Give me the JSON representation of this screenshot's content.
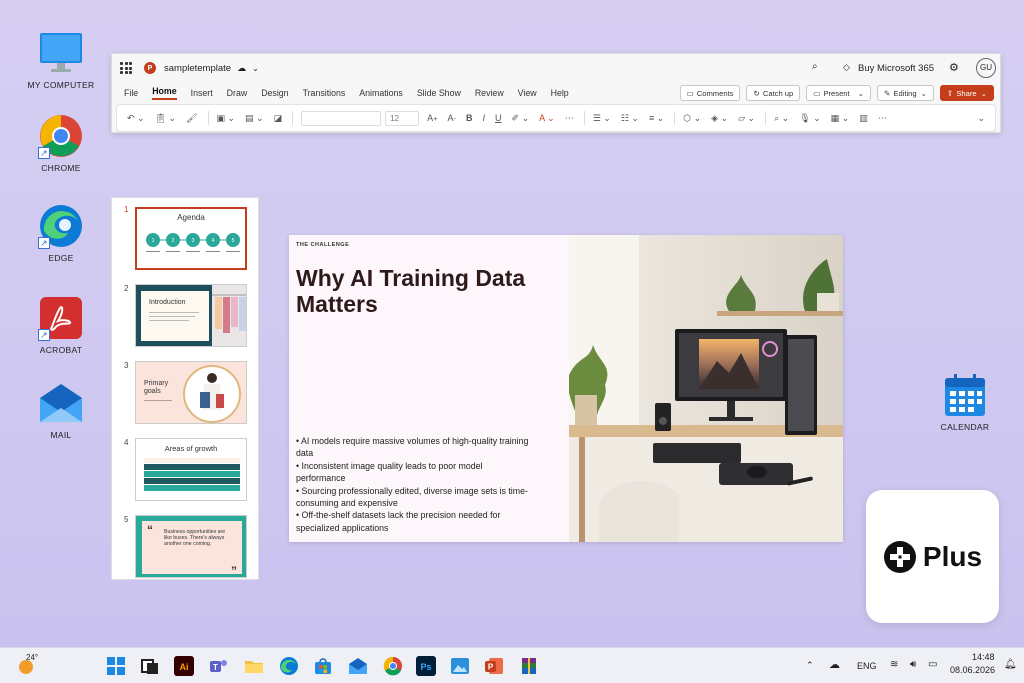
{
  "desktop": {
    "icons": [
      {
        "label": "MY COMPUTER"
      },
      {
        "label": "CHROME"
      },
      {
        "label": "EDGE"
      },
      {
        "label": "ACROBAT"
      },
      {
        "label": "MAIL"
      },
      {
        "label": "CALENDAR"
      }
    ]
  },
  "window": {
    "file_name": "sampletemplate",
    "buy_label": "Buy Microsoft 365",
    "avatar": "GU",
    "menu": [
      "File",
      "Home",
      "Insert",
      "Draw",
      "Design",
      "Transitions",
      "Animations",
      "Slide Show",
      "Review",
      "View",
      "Help"
    ],
    "active_menu": "Home",
    "comments_label": "Comments",
    "catchup_label": "Catch up",
    "present_label": "Present",
    "editing_label": "Editing",
    "share_label": "Share",
    "font_size": "12"
  },
  "thumbnails": [
    {
      "num": "1",
      "title": "Agenda"
    },
    {
      "num": "2",
      "title": "Introduction"
    },
    {
      "num": "3",
      "title": "Primary goals"
    },
    {
      "num": "4",
      "title": "Areas of growth"
    },
    {
      "num": "5",
      "quote": "Business opportunities are like buses. There's always another one coming."
    }
  ],
  "slide": {
    "kicker": "THE CHALLENGE",
    "title": "Why AI Training Data Matters",
    "bullets": [
      "• AI models require massive volumes of high-quality training data",
      "• Inconsistent image quality leads to poor model performance",
      "• Sourcing professionally edited, diverse image sets is time-consuming and expensive",
      "• Off-the-shelf datasets lack the precision needed for specialized applications"
    ]
  },
  "plus_widget": {
    "label": "Plus"
  },
  "taskbar": {
    "weather": "24°",
    "lang": "ENG",
    "time": "14:48",
    "date": "08.06.2026"
  },
  "colors": {
    "accent": "#c43e1c",
    "teal": "#2aa99b"
  }
}
